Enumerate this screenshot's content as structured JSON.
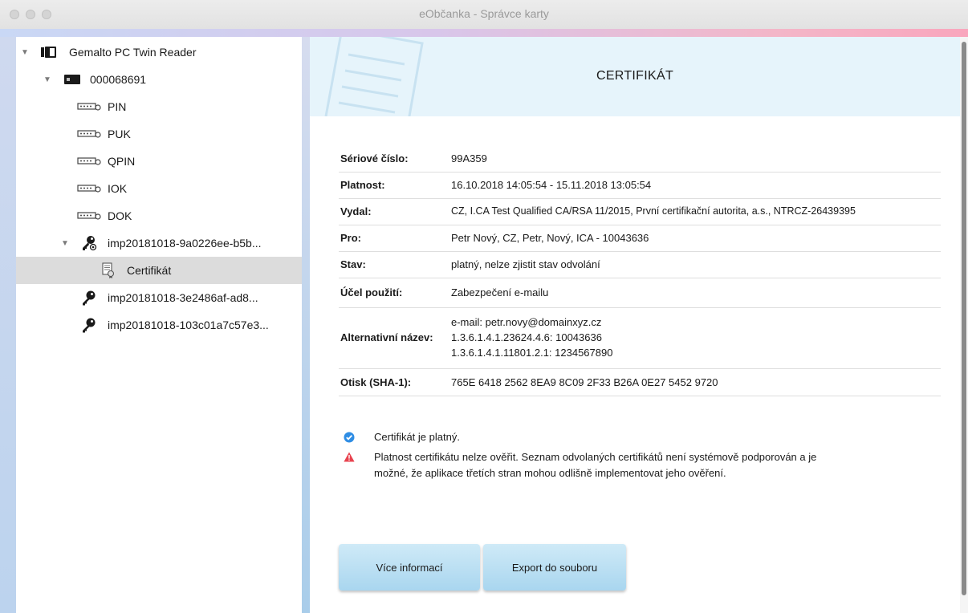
{
  "window": {
    "title": "eObčanka - Správce karty"
  },
  "tree": {
    "reader": "Gemalto PC Twin Reader",
    "card": "000068691",
    "pins": [
      "PIN",
      "PUK",
      "QPIN",
      "IOK",
      "DOK"
    ],
    "keys": [
      {
        "label": "imp20181018-9a0226ee-b5b..."
      },
      {
        "label": "imp20181018-3e2486af-ad8..."
      },
      {
        "label": "imp20181018-103c01a7c57e3..."
      }
    ],
    "certificate": "Certifikát"
  },
  "main": {
    "title": "CERTIFIKÁT",
    "fields": [
      {
        "label": "Sériové číslo:",
        "value": "99A359"
      },
      {
        "label": "Platnost:",
        "value": "16.10.2018 14:05:54 - 15.11.2018 13:05:54"
      },
      {
        "label": "Vydal:",
        "value": "CZ, I.CA Test Qualified CA/RSA 11/2015, První certifikační autorita, a.s., NTRCZ-26439395"
      },
      {
        "label": "Pro:",
        "value": "Petr Nový, CZ, Petr, Nový, ICA - 10043636"
      },
      {
        "label": "Stav:",
        "value": "platný, nelze zjistit stav odvolání"
      },
      {
        "label": "Účel použití:",
        "value": "Zabezpečení e-mailu"
      }
    ],
    "alt_name": {
      "label": "Alternativní název:",
      "lines": [
        "e-mail: petr.novy@domainxyz.cz",
        "1.3.6.1.4.1.23624.4.6: 10043636",
        "1.3.6.1.4.1.11801.2.1: 1234567890"
      ]
    },
    "thumbprint": {
      "label": "Otisk (SHA-1):",
      "value": "765E 6418 2562 8EA9 8C09 2F33 B26A 0E27 5452 9720"
    },
    "messages": {
      "ok": "Certifikát je platný.",
      "warn_line1": "Platnost certifikátu nelze ověřit. Seznam odvolaných certifikátů není systémově podporován a je",
      "warn_line2": "možné, že aplikace třetích stran mohou odlišně implementovat jeho ověření."
    },
    "buttons": {
      "more": "Více informací",
      "export": "Export do souboru"
    }
  },
  "colors": {
    "ok_icon": "#2f8de4",
    "warn_icon": "#e8434f",
    "button": "#b9def2"
  }
}
